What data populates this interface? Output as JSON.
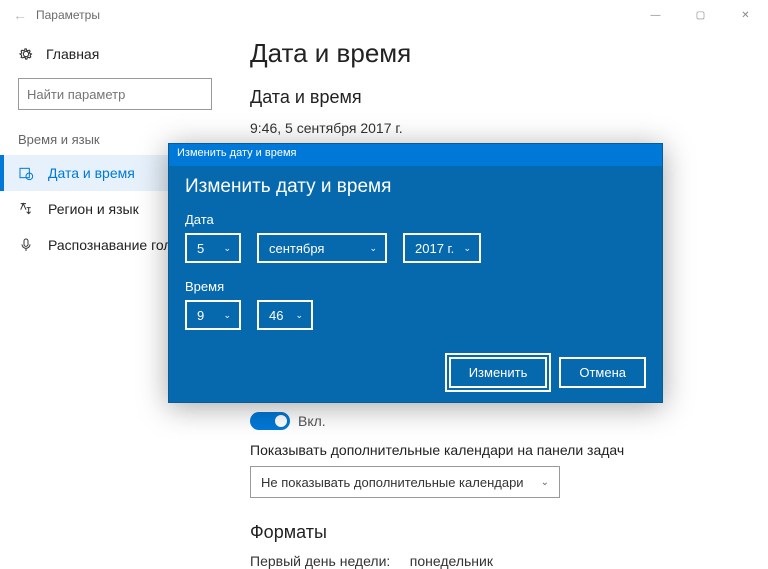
{
  "window": {
    "title": "Параметры",
    "win_min": "—",
    "win_max": "▢",
    "win_close": "✕"
  },
  "sidebar": {
    "home": "Главная",
    "search_placeholder": "Найти параметр",
    "category": "Время и язык",
    "items": [
      {
        "label": "Дата и время"
      },
      {
        "label": "Регион и язык"
      },
      {
        "label": "Распознавание голоса"
      }
    ]
  },
  "main": {
    "h1": "Дата и время",
    "h2": "Дата и время",
    "datetime": "9:46, 5 сентября 2017 г.",
    "toggle_label": "Вкл.",
    "extra_cal_text": "Показывать дополнительные календари на панели задач",
    "extra_cal_select": "Не показывать дополнительные календари",
    "formats_h": "Форматы",
    "first_day_label": "Первый день недели:",
    "first_day_value": "понедельник"
  },
  "dialog": {
    "titlebar": "Изменить дату и время",
    "heading": "Изменить дату и время",
    "date_label": "Дата",
    "date_day": "5",
    "date_month": "сентября",
    "date_year": "2017 г.",
    "time_label": "Время",
    "time_hour": "9",
    "time_minute": "46",
    "btn_change": "Изменить",
    "btn_cancel": "Отмена"
  }
}
